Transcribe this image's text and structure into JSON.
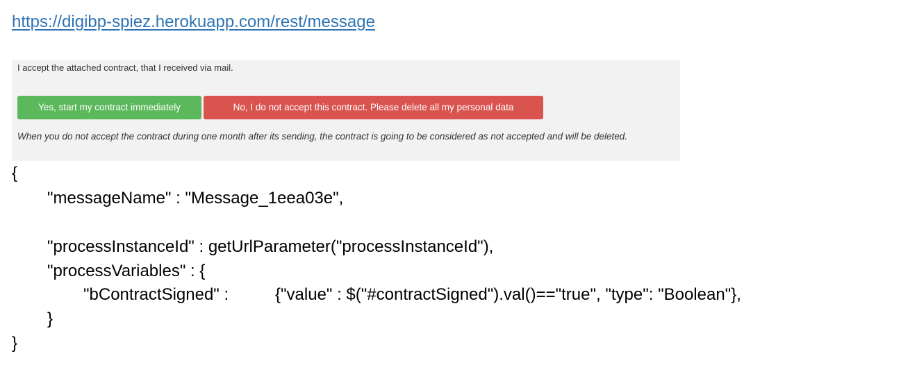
{
  "url": "https://digibp-spiez.herokuapp.com/rest/message",
  "panel": {
    "prompt": "I accept the attached contract, that I received via mail.",
    "accept_label": "Yes, start my contract immediately",
    "reject_label": "No, I do not accept this contract. Please delete all my personal data",
    "note": "When you do not accept the contract during one month after its sending, the contract is going to be considered as not accepted and will be deleted."
  },
  "code": {
    "open_brace": "{",
    "message_name": "\"messageName\" : \"Message_1eea03e\",",
    "process_instance_id": "\"processInstanceId\" : getUrlParameter(\"processInstanceId\"),",
    "process_variables_open": "\"processVariables\" : {",
    "contract_signed_key": "\"bContractSigned\" :",
    "contract_signed_value": "{\"value\" : $(\"#contractSigned\").val()==\"true\", \"type\": \"Boolean\"},",
    "inner_close_brace": "}",
    "close_brace": "}"
  },
  "colors": {
    "link": "#2e74b5",
    "accept_button": "#5cb85c",
    "reject_button": "#d9534f",
    "panel_background": "#f2f2f2"
  }
}
